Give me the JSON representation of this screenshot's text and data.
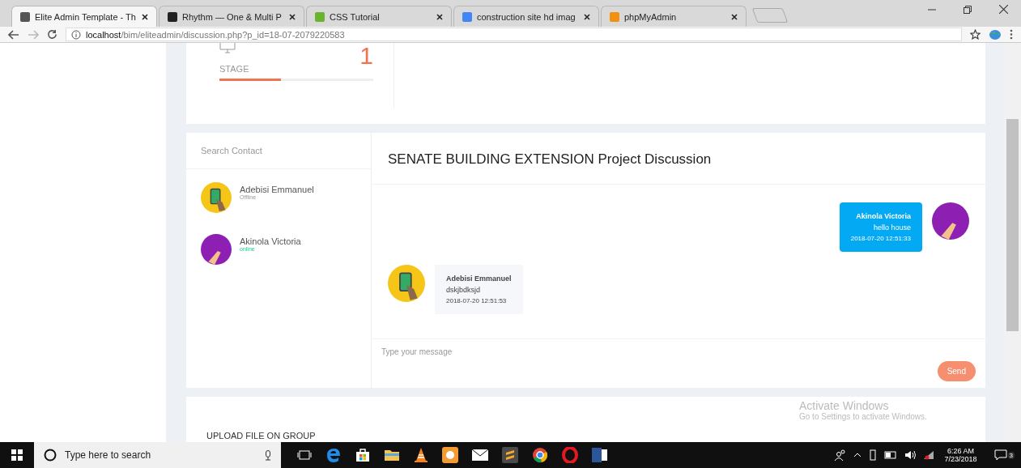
{
  "browser": {
    "tabs": [
      {
        "title": "Elite Admin Template - Th",
        "selected": true
      },
      {
        "title": "Rhythm — One & Multi P",
        "selected": false
      },
      {
        "title": "CSS Tutorial",
        "selected": false
      },
      {
        "title": "construction site hd imag",
        "selected": false
      },
      {
        "title": "phpMyAdmin",
        "selected": false
      }
    ],
    "address": {
      "host": "localhost",
      "path": "/bim/eliteadmin/discussion.php?p_id=18-07-2079220583"
    }
  },
  "stage": {
    "label": "STAGE",
    "count": "1",
    "level": 0.4
  },
  "contacts": {
    "search_placeholder": "Search Contact",
    "items": [
      {
        "name": "Adebisi Emmanuel",
        "status": "Offline",
        "online": false,
        "color": "#f5c518"
      },
      {
        "name": "Akinola Victoria",
        "status": "online",
        "online": true,
        "color": "#8e1fb3"
      }
    ]
  },
  "discussion": {
    "title": "SENATE BUILDING EXTENSION Project Discussion",
    "messages": [
      {
        "name": "Akinola Victoria",
        "text": "hello house",
        "time": "2018-07-20 12:51:33",
        "own": true,
        "color": "#8e1fb3"
      },
      {
        "name": "Adebisi Emmanuel",
        "text": "dskjbdksjd",
        "time": "2018-07-20 12:51:53",
        "own": false,
        "color": "#f5c518"
      }
    ],
    "input_placeholder": "Type your message",
    "send": "Send"
  },
  "upload": {
    "title": "UPLOAD FILE ON GROUP"
  },
  "activation": {
    "title": "Activate Windows",
    "subtitle": "Go to Settings to activate Windows."
  },
  "taskbar": {
    "search_placeholder": "Type here to search",
    "time": "6:26 AM",
    "date": "7/23/2018",
    "notifications": "3"
  }
}
